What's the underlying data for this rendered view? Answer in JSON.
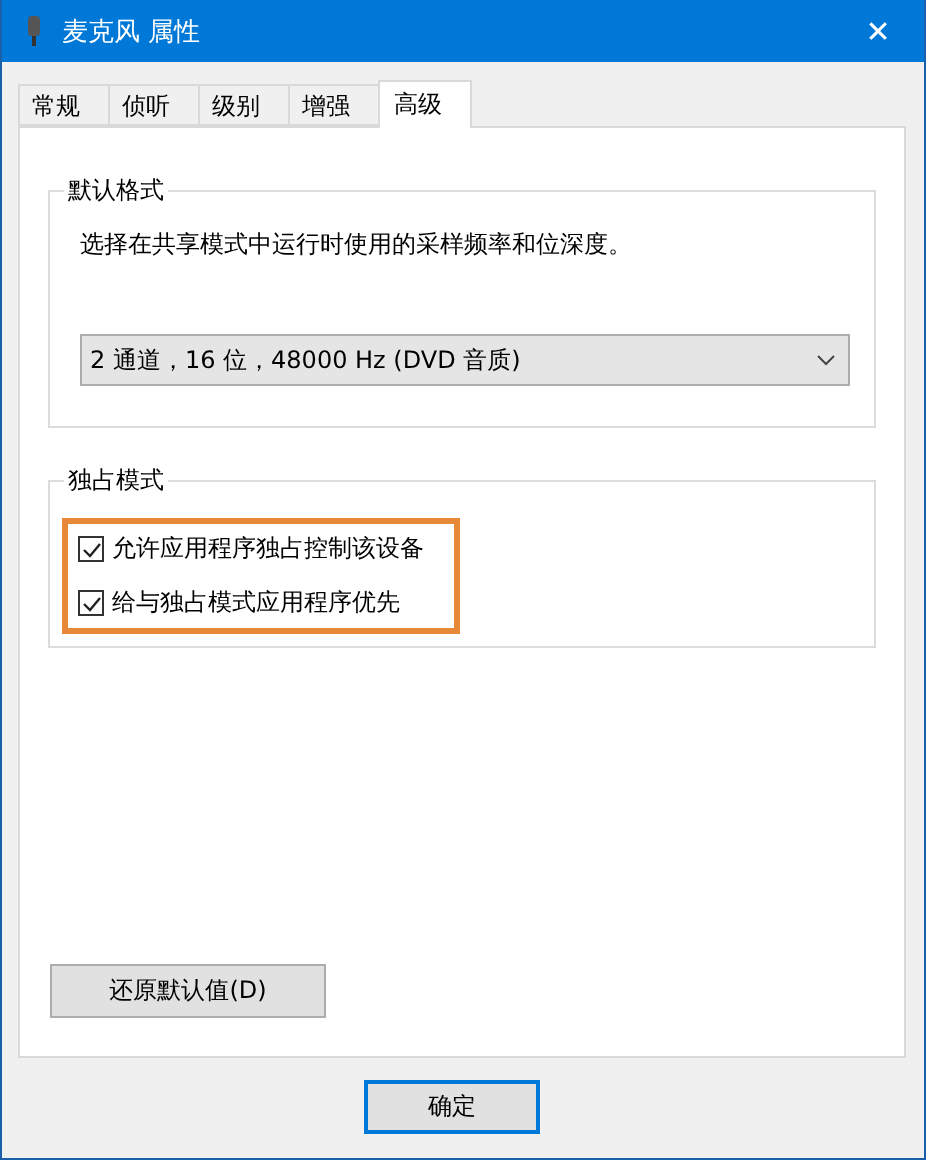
{
  "window": {
    "title": "麦克风 属性",
    "close": "✕"
  },
  "tabs": [
    {
      "label": "常规",
      "selected": false
    },
    {
      "label": "侦听",
      "selected": false
    },
    {
      "label": "级别",
      "selected": false
    },
    {
      "label": "增强",
      "selected": false
    },
    {
      "label": "高级",
      "selected": true
    }
  ],
  "default_format": {
    "title": "默认格式",
    "description": "选择在共享模式中运行时使用的采样频率和位深度。",
    "format_select": {
      "value": "2 通道，16 位，48000 Hz (DVD 音质)"
    }
  },
  "exclusive_mode": {
    "title": "独占模式",
    "highlighted": true,
    "options": [
      {
        "label": "允许应用程序独占控制该设备",
        "checked": true
      },
      {
        "label": "给与独占模式应用程序优先",
        "checked": true
      }
    ]
  },
  "restore_button": "还原默认值(D)",
  "buttons": [
    {
      "label": "确定",
      "default": true
    }
  ]
}
